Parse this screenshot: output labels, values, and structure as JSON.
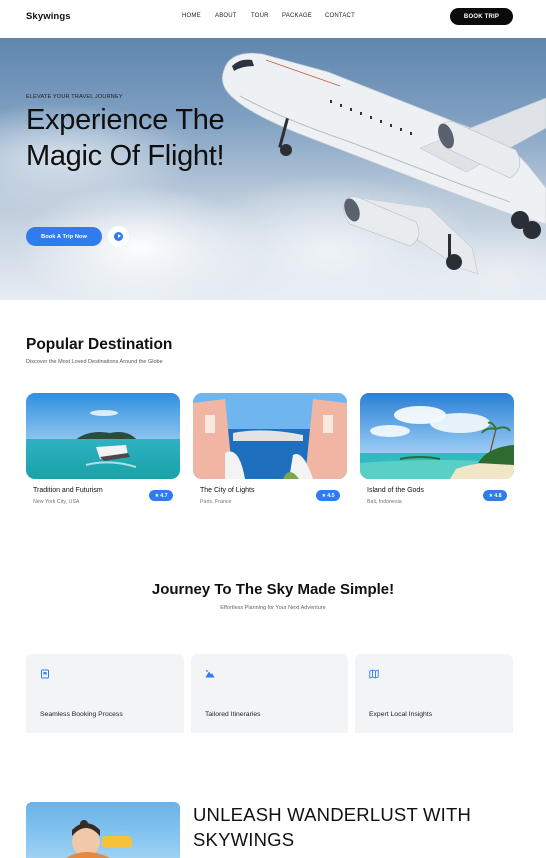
{
  "nav": {
    "logo": "Skywings",
    "links": [
      "HOME",
      "ABOUT",
      "TOUR",
      "PACKAGE",
      "CONTACT"
    ],
    "book_button": "BOOK TRIP"
  },
  "hero": {
    "eyebrow": "ELEVATE YOUR TRAVEL JOURNEY",
    "title": "Experience The Magic Of Flight!",
    "cta": "Book A Trip Now"
  },
  "popular": {
    "title": "Popular Destination",
    "subtitle": "Discover the Most Loved Destinations Around the Globe",
    "cards": [
      {
        "name": "Tradition and Futurism",
        "location": "New York City, USA",
        "rating": "4.7"
      },
      {
        "name": "The City of Lights",
        "location": "Paris, France",
        "rating": "4.5"
      },
      {
        "name": "Island of the Gods",
        "location": "Bali, Indonesia",
        "rating": "4.8"
      }
    ]
  },
  "journey": {
    "title": "Journey To The Sky Made Simple!",
    "subtitle": "Effortless Planning for Your Next Adventure",
    "features": [
      {
        "label": "Seamless Booking Process",
        "icon": "bookmark-icon"
      },
      {
        "label": "Tailored Itineraries",
        "icon": "mountain-icon"
      },
      {
        "label": "Expert Local Insights",
        "icon": "map-icon"
      }
    ]
  },
  "about": {
    "title": "UNLEASH WANDERLUST WITH SKYWINGS"
  },
  "colors": {
    "accent": "#2f7bf0",
    "dark": "#0b0b0b",
    "card_bg": "#f3f4f6"
  }
}
